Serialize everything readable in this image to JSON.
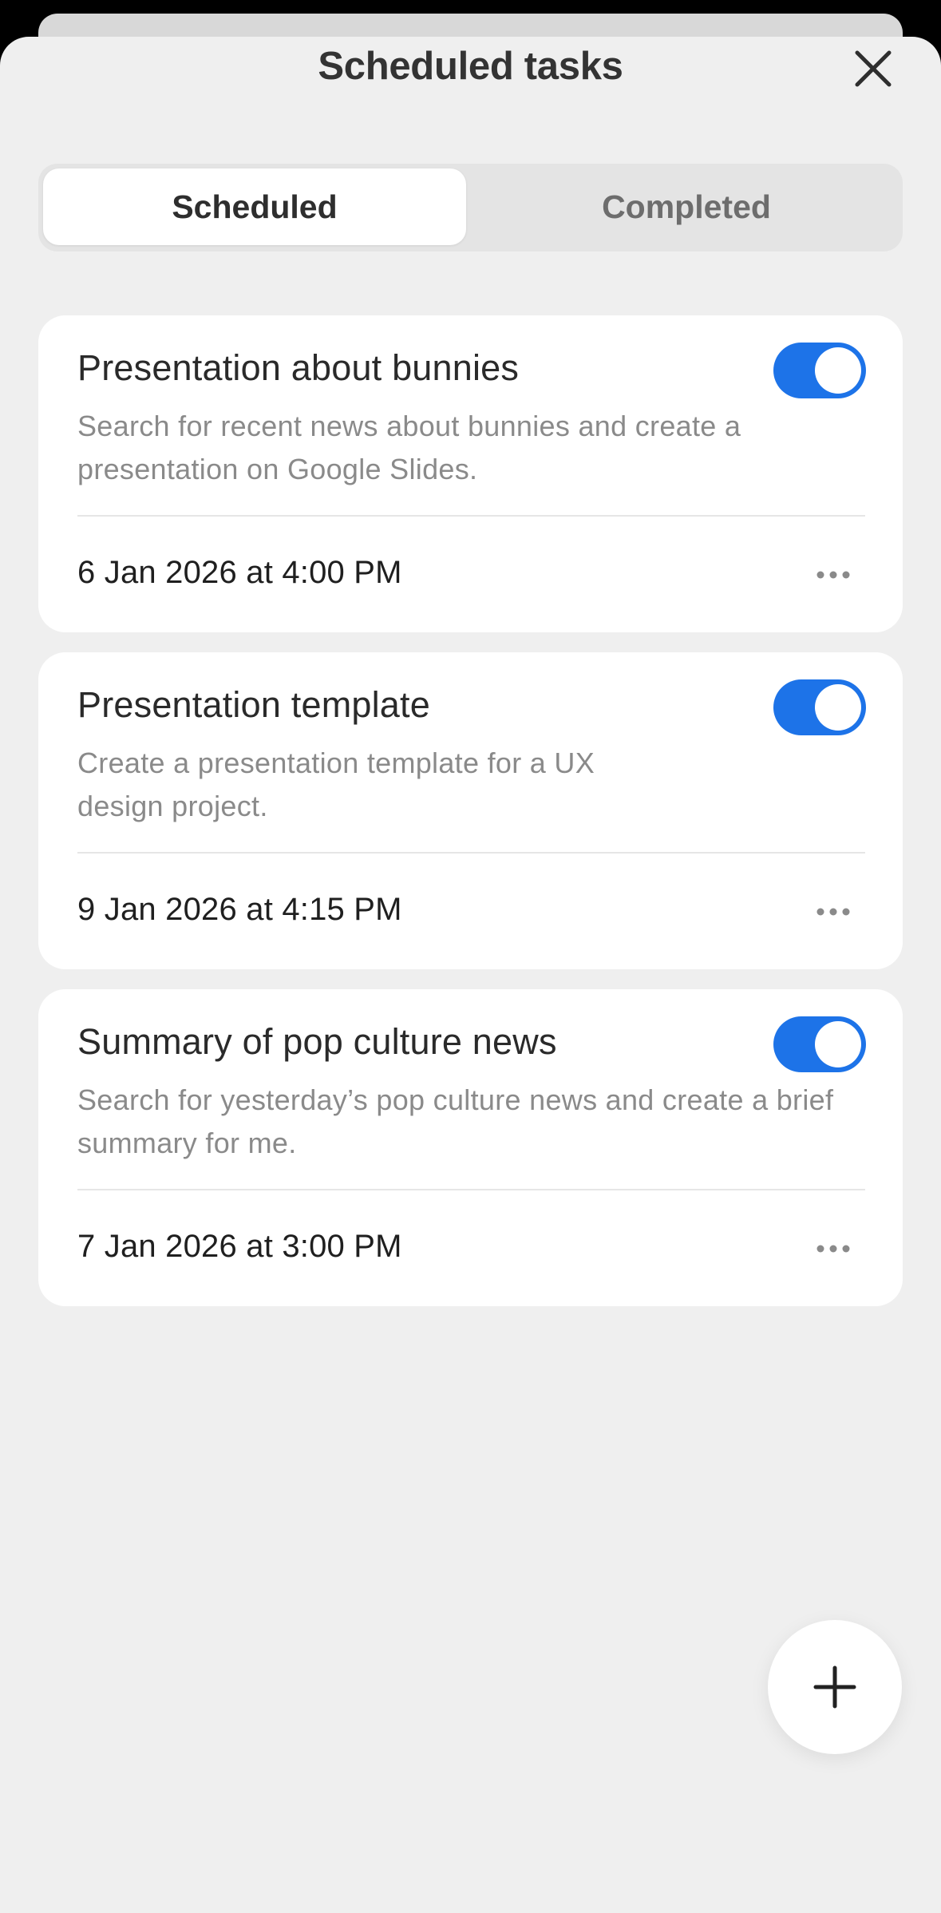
{
  "header": {
    "title": "Scheduled tasks",
    "close_icon": "close-icon"
  },
  "tabs": [
    {
      "label": "Scheduled",
      "selected": true
    },
    {
      "label": "Completed",
      "selected": false
    }
  ],
  "tasks": [
    {
      "title": "Presentation about bunnies",
      "description": "Search for recent news about bunnies and create a presentation on Google Slides.",
      "date": "6 Jan 2026 at 4:00 PM",
      "enabled": true
    },
    {
      "title": "Presentation template",
      "description": "Create a presentation template for a UX design project.",
      "date": "9 Jan 2026 at 4:15 PM",
      "enabled": true
    },
    {
      "title": "Summary of pop culture news",
      "description": "Search for yesterday’s pop culture news and create a brief summary for me.",
      "date": "7 Jan 2026 at 3:00 PM",
      "enabled": true
    }
  ],
  "fab": {
    "icon": "plus-icon"
  },
  "colors": {
    "accent": "#1d73e8",
    "sheet_background": "#efefef",
    "card_background": "#ffffff"
  }
}
